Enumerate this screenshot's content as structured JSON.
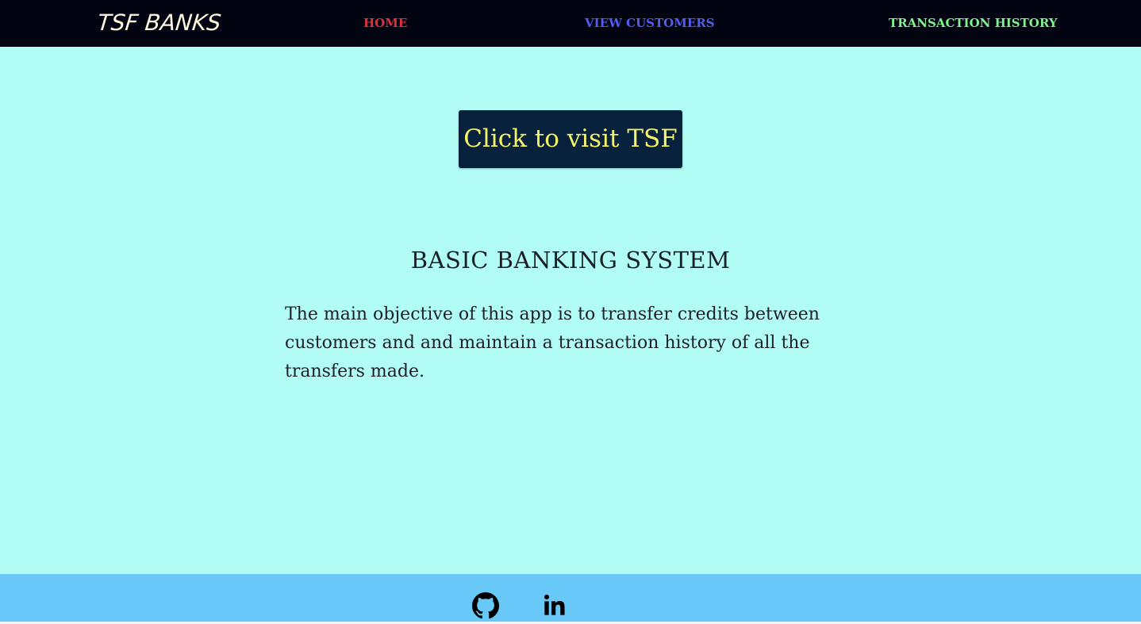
{
  "navbar": {
    "brand": "TSF BANKS",
    "links": [
      {
        "label": "HOME",
        "color": "#e0303f"
      },
      {
        "label": "VIEW CUSTOMERS",
        "color": "#4f5df2"
      },
      {
        "label": "TRANSACTION HISTORY",
        "color": "#7ff28f"
      }
    ]
  },
  "main": {
    "visit_button_label": "Click to visit TSF",
    "title": "BASIC BANKING SYSTEM",
    "description": "The main objective of this app is to transfer credits between customers and and maintain a transaction history of all the transfers made."
  },
  "footer": {
    "icons": [
      "github-icon",
      "linkedin-icon"
    ]
  },
  "colors": {
    "page_background": "#b2fcf6",
    "navbar_background": "#020412",
    "button_background": "#08213d",
    "button_text": "#f5f469",
    "footer_background": "#68c9f9"
  }
}
